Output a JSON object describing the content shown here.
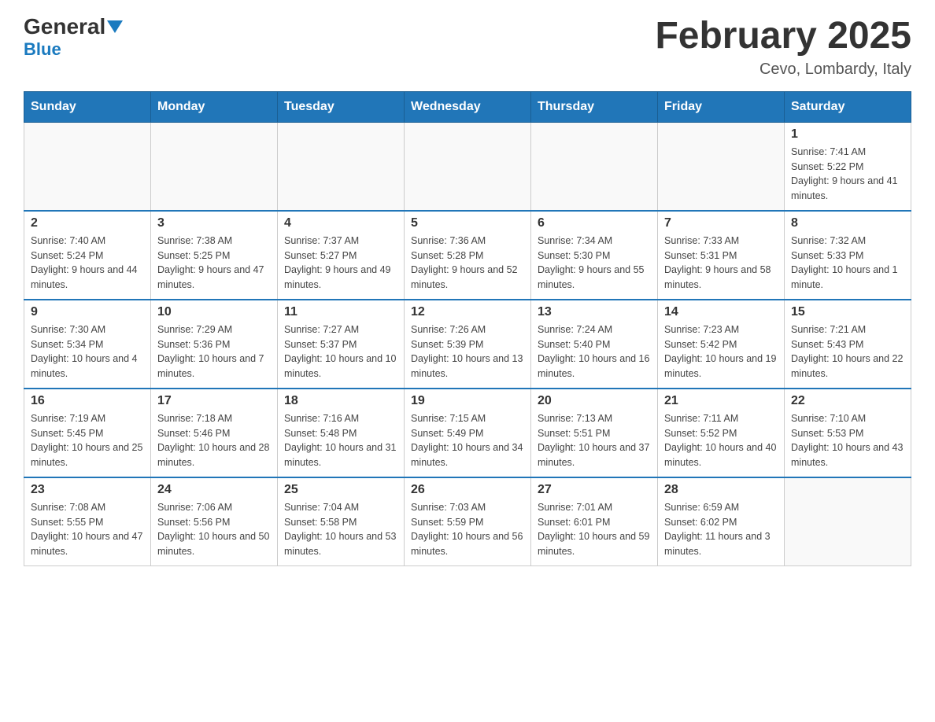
{
  "header": {
    "logo_general": "General",
    "logo_blue": "Blue",
    "month_title": "February 2025",
    "location": "Cevo, Lombardy, Italy"
  },
  "days_of_week": [
    "Sunday",
    "Monday",
    "Tuesday",
    "Wednesday",
    "Thursday",
    "Friday",
    "Saturday"
  ],
  "weeks": [
    {
      "days": [
        {
          "num": "",
          "info": ""
        },
        {
          "num": "",
          "info": ""
        },
        {
          "num": "",
          "info": ""
        },
        {
          "num": "",
          "info": ""
        },
        {
          "num": "",
          "info": ""
        },
        {
          "num": "",
          "info": ""
        },
        {
          "num": "1",
          "info": "Sunrise: 7:41 AM\nSunset: 5:22 PM\nDaylight: 9 hours and 41 minutes."
        }
      ]
    },
    {
      "days": [
        {
          "num": "2",
          "info": "Sunrise: 7:40 AM\nSunset: 5:24 PM\nDaylight: 9 hours and 44 minutes."
        },
        {
          "num": "3",
          "info": "Sunrise: 7:38 AM\nSunset: 5:25 PM\nDaylight: 9 hours and 47 minutes."
        },
        {
          "num": "4",
          "info": "Sunrise: 7:37 AM\nSunset: 5:27 PM\nDaylight: 9 hours and 49 minutes."
        },
        {
          "num": "5",
          "info": "Sunrise: 7:36 AM\nSunset: 5:28 PM\nDaylight: 9 hours and 52 minutes."
        },
        {
          "num": "6",
          "info": "Sunrise: 7:34 AM\nSunset: 5:30 PM\nDaylight: 9 hours and 55 minutes."
        },
        {
          "num": "7",
          "info": "Sunrise: 7:33 AM\nSunset: 5:31 PM\nDaylight: 9 hours and 58 minutes."
        },
        {
          "num": "8",
          "info": "Sunrise: 7:32 AM\nSunset: 5:33 PM\nDaylight: 10 hours and 1 minute."
        }
      ]
    },
    {
      "days": [
        {
          "num": "9",
          "info": "Sunrise: 7:30 AM\nSunset: 5:34 PM\nDaylight: 10 hours and 4 minutes."
        },
        {
          "num": "10",
          "info": "Sunrise: 7:29 AM\nSunset: 5:36 PM\nDaylight: 10 hours and 7 minutes."
        },
        {
          "num": "11",
          "info": "Sunrise: 7:27 AM\nSunset: 5:37 PM\nDaylight: 10 hours and 10 minutes."
        },
        {
          "num": "12",
          "info": "Sunrise: 7:26 AM\nSunset: 5:39 PM\nDaylight: 10 hours and 13 minutes."
        },
        {
          "num": "13",
          "info": "Sunrise: 7:24 AM\nSunset: 5:40 PM\nDaylight: 10 hours and 16 minutes."
        },
        {
          "num": "14",
          "info": "Sunrise: 7:23 AM\nSunset: 5:42 PM\nDaylight: 10 hours and 19 minutes."
        },
        {
          "num": "15",
          "info": "Sunrise: 7:21 AM\nSunset: 5:43 PM\nDaylight: 10 hours and 22 minutes."
        }
      ]
    },
    {
      "days": [
        {
          "num": "16",
          "info": "Sunrise: 7:19 AM\nSunset: 5:45 PM\nDaylight: 10 hours and 25 minutes."
        },
        {
          "num": "17",
          "info": "Sunrise: 7:18 AM\nSunset: 5:46 PM\nDaylight: 10 hours and 28 minutes."
        },
        {
          "num": "18",
          "info": "Sunrise: 7:16 AM\nSunset: 5:48 PM\nDaylight: 10 hours and 31 minutes."
        },
        {
          "num": "19",
          "info": "Sunrise: 7:15 AM\nSunset: 5:49 PM\nDaylight: 10 hours and 34 minutes."
        },
        {
          "num": "20",
          "info": "Sunrise: 7:13 AM\nSunset: 5:51 PM\nDaylight: 10 hours and 37 minutes."
        },
        {
          "num": "21",
          "info": "Sunrise: 7:11 AM\nSunset: 5:52 PM\nDaylight: 10 hours and 40 minutes."
        },
        {
          "num": "22",
          "info": "Sunrise: 7:10 AM\nSunset: 5:53 PM\nDaylight: 10 hours and 43 minutes."
        }
      ]
    },
    {
      "days": [
        {
          "num": "23",
          "info": "Sunrise: 7:08 AM\nSunset: 5:55 PM\nDaylight: 10 hours and 47 minutes."
        },
        {
          "num": "24",
          "info": "Sunrise: 7:06 AM\nSunset: 5:56 PM\nDaylight: 10 hours and 50 minutes."
        },
        {
          "num": "25",
          "info": "Sunrise: 7:04 AM\nSunset: 5:58 PM\nDaylight: 10 hours and 53 minutes."
        },
        {
          "num": "26",
          "info": "Sunrise: 7:03 AM\nSunset: 5:59 PM\nDaylight: 10 hours and 56 minutes."
        },
        {
          "num": "27",
          "info": "Sunrise: 7:01 AM\nSunset: 6:01 PM\nDaylight: 10 hours and 59 minutes."
        },
        {
          "num": "28",
          "info": "Sunrise: 6:59 AM\nSunset: 6:02 PM\nDaylight: 11 hours and 3 minutes."
        },
        {
          "num": "",
          "info": ""
        }
      ]
    }
  ]
}
